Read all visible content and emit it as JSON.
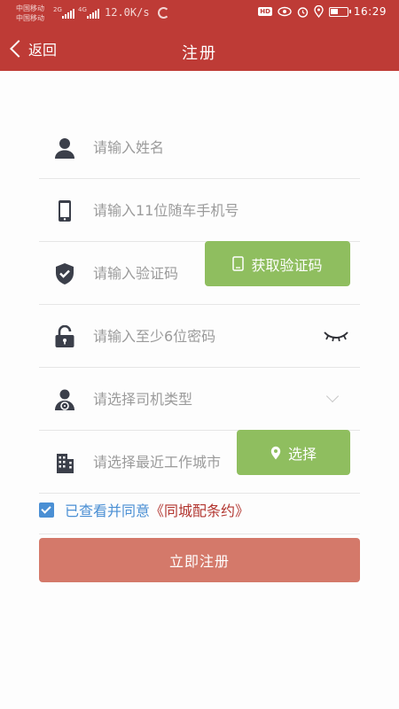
{
  "status_bar": {
    "carrier_1": "中国移动",
    "carrier_2": "中国移动",
    "net_1": "2G",
    "net_2": "4G",
    "speed": "12.0K/s",
    "time": "16:29",
    "hd_badge": "HD"
  },
  "header": {
    "back_label": "返回",
    "title": "注册",
    "color": "#be3b36"
  },
  "form": {
    "name_placeholder": "请输入姓名",
    "phone_placeholder": "请输入11位随车手机号",
    "code_placeholder": "请输入验证码",
    "get_code_label": "获取验证码",
    "password_placeholder": "请输入至少6位密码",
    "driver_type_placeholder": "请选择司机类型",
    "city_placeholder": "请选择最近工作城市",
    "select_city_label": "选择"
  },
  "agreement": {
    "checked": true,
    "text": "已查看并同意",
    "link": "《同城配条约》"
  },
  "submit_label": "立即注册",
  "colors": {
    "accent_green": "#8fbe5f",
    "submit_bg": "#d4796a",
    "link_blue": "#4a8fd4"
  }
}
